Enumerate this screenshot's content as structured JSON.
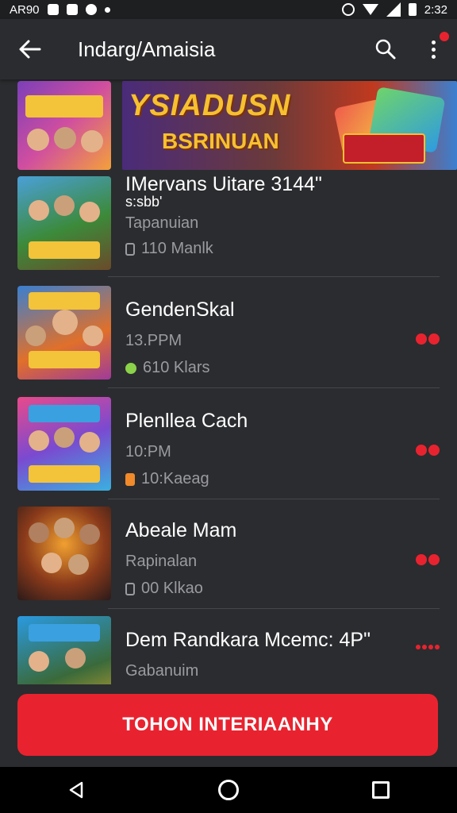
{
  "status_bar": {
    "carrier": "AR90",
    "time": "2:32"
  },
  "app_bar": {
    "title": "Indarg/Amaisia",
    "back_icon": "arrow-left-icon",
    "search_icon": "search-icon",
    "menu_icon": "more-vert-icon"
  },
  "banner": {
    "title": "YSIADUSN",
    "subtitle": "BSRINUAN"
  },
  "items": [
    {
      "name": "IMervans Uitare 3144\"",
      "extra": "s:sbb'",
      "subtitle": "Tapanuian",
      "meta": "110 Manlk",
      "badge": false
    },
    {
      "name": "GendenSkal",
      "extra": "",
      "subtitle": "13.PPM",
      "meta": "610 Klars",
      "badge": true
    },
    {
      "name": "Plenllea Cach",
      "extra": "",
      "subtitle": "10:PM",
      "meta": "10:Kaeag",
      "badge": true
    },
    {
      "name": "Abeale Mam",
      "extra": "",
      "subtitle": "Rapinalan",
      "meta": "00 Klkao",
      "badge": true
    },
    {
      "name": "Dem Randkara Mcemc: 4P\"",
      "extra": "",
      "subtitle": "Gabanuim",
      "meta": "",
      "badge": true
    }
  ],
  "cta": {
    "label": "TOHON INTERIAANHY"
  },
  "colors": {
    "accent": "#e8232f",
    "background": "#2b2c2f"
  }
}
